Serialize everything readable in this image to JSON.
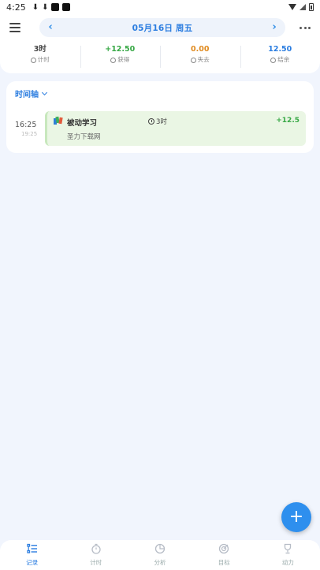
{
  "status_bar": {
    "time": "4:25"
  },
  "header": {
    "date": "05月16日 周五",
    "prev_arrow": "‹",
    "next_arrow": "›"
  },
  "stats": [
    {
      "value": "3时",
      "label": "计时",
      "color": "#444444"
    },
    {
      "value": "+12.50",
      "label": "获得",
      "color": "#37a845"
    },
    {
      "value": "0.00",
      "label": "失去",
      "color": "#e08a1e"
    },
    {
      "value": "12.50",
      "label": "结余",
      "color": "#2b7de0"
    }
  ],
  "timeline": {
    "header": "时间轴",
    "entries": [
      {
        "start_time": "16:25",
        "end_time": "19:25",
        "title": "被动学习",
        "duration": "3时",
        "score": "+12.5",
        "note": "圣力下载网"
      }
    ]
  },
  "fab": {
    "label": "+"
  },
  "bottom_nav": [
    {
      "label": "记录",
      "icon": "record-icon",
      "active": true
    },
    {
      "label": "计时",
      "icon": "timer-icon",
      "active": false
    },
    {
      "label": "分析",
      "icon": "pie-chart-icon",
      "active": false
    },
    {
      "label": "目标",
      "icon": "target-icon",
      "active": false
    },
    {
      "label": "动力",
      "icon": "trophy-icon",
      "active": false
    }
  ]
}
